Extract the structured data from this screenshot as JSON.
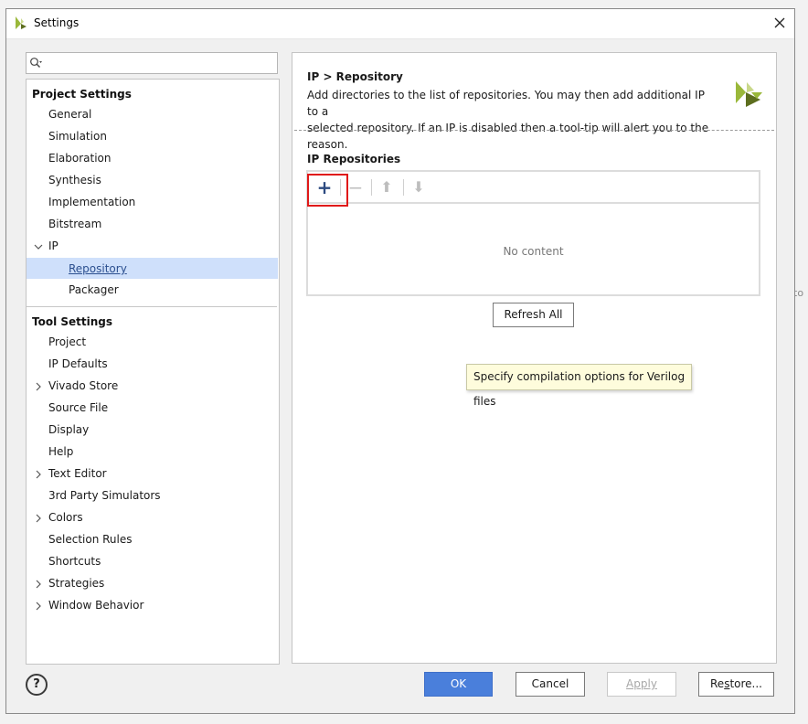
{
  "window": {
    "title": "Settings",
    "background_hint": "to"
  },
  "search": {
    "value": "",
    "placeholder": ""
  },
  "tree": {
    "project_settings": {
      "label": "Project Settings",
      "items": [
        "General",
        "Simulation",
        "Elaboration",
        "Synthesis",
        "Implementation",
        "Bitstream"
      ],
      "ip": {
        "label": "IP",
        "children": [
          "Repository",
          "Packager"
        ],
        "selected": "Repository"
      }
    },
    "tool_settings": {
      "label": "Tool Settings",
      "items": [
        {
          "label": "Project",
          "expandable": false
        },
        {
          "label": "IP Defaults",
          "expandable": false
        },
        {
          "label": "Vivado Store",
          "expandable": true
        },
        {
          "label": "Source File",
          "expandable": false
        },
        {
          "label": "Display",
          "expandable": false
        },
        {
          "label": "Help",
          "expandable": false
        },
        {
          "label": "Text Editor",
          "expandable": true
        },
        {
          "label": "3rd Party Simulators",
          "expandable": false
        },
        {
          "label": "Colors",
          "expandable": true
        },
        {
          "label": "Selection Rules",
          "expandable": false
        },
        {
          "label": "Shortcuts",
          "expandable": false
        },
        {
          "label": "Strategies",
          "expandable": true
        },
        {
          "label": "Window Behavior",
          "expandable": true
        }
      ]
    }
  },
  "content": {
    "title": "IP > Repository",
    "description_line1": "Add directories to the list of repositories. You may then add additional IP to a",
    "description_line2": "selected repository. If an IP is disabled then a tool-tip will alert you to the reason.",
    "section_label": "IP Repositories",
    "empty_text": "No content",
    "refresh_label": "Refresh All",
    "tooltip": "Specify compilation options for Verilog files"
  },
  "toolbar": {
    "add": "+",
    "remove": "−",
    "up": "⬆",
    "down": "⬇"
  },
  "footer": {
    "help": "?",
    "ok": "OK",
    "cancel": "Cancel",
    "apply": "Apply",
    "restore_prefix": "Re",
    "restore_underlined": "s",
    "restore_suffix": "tore..."
  },
  "colors": {
    "accent": "#4a7fdb",
    "selection": "#cfe0fb",
    "highlight_box": "#e01919",
    "logo_green": "#9ab83a",
    "logo_dark": "#5d6e1e"
  }
}
